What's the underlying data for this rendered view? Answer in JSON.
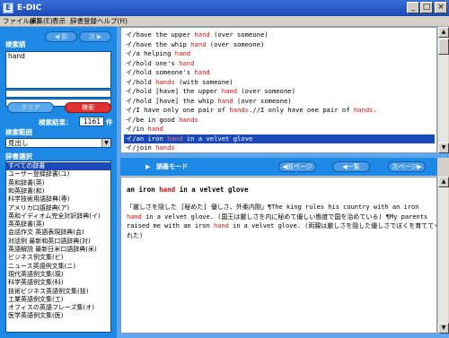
{
  "window": {
    "title": "E-DIC",
    "minimize": "_",
    "maximize": "□",
    "close": "×"
  },
  "menu": [
    "ファイル(F)",
    "編集(E)",
    "表示",
    "辞書登録",
    "ヘルプ(H)"
  ],
  "left": {
    "search_label": "検索語",
    "nav_back": "前",
    "nav_forward": "次",
    "search_value": "hand",
    "clear_button": "クリア",
    "search_button": "検索",
    "results_count_label": "検索結果：",
    "results_count": "1161",
    "results_unit": "件",
    "search_range_label": "検索範囲",
    "search_range_value": "見出し",
    "dict_select_label": "辞書選択",
    "dictionaries": [
      "すべての辞書",
      "ユーザー登録辞書(ユ)",
      "英和辞書(英)",
      "和英辞書(和)",
      "科学技術用語辞典(専)",
      "アメリカ口語辞典(ア)",
      "英和イディオム完全対訳辞典(イ)",
      "英英辞書(英)",
      "会話作文 英語表現辞典(会)",
      "対話例 最新和英口語辞典(対)",
      "英語解説 最新日米口語辞典(米)",
      "ビジネス例文集(ビ)",
      "ニュース英語例文集(ニ)",
      "現代英語例文集(現)",
      "科学英語例文集(科)",
      "技術ビジネス英語例文集(技)",
      "工業英語例文集(工)",
      "オフィスの英語フレーズ集(オ)",
      "医学英語例文集(医)"
    ],
    "selected_dictionary_index": 0
  },
  "results": {
    "items": [
      {
        "prefix": "イ/",
        "parts": [
          "have the upper ",
          "hand",
          " (over someone)"
        ]
      },
      {
        "prefix": "イ/",
        "parts": [
          "have the whip ",
          "hand",
          " (over someone)"
        ]
      },
      {
        "prefix": "イ/",
        "parts": [
          "a helping ",
          "hand",
          ""
        ]
      },
      {
        "prefix": "イ/",
        "parts": [
          "hold one's ",
          "hand",
          ""
        ]
      },
      {
        "prefix": "イ/",
        "parts": [
          "hold someone's ",
          "hand",
          ""
        ]
      },
      {
        "prefix": "イ/",
        "parts": [
          "hold ",
          "hands",
          " (with someone)"
        ]
      },
      {
        "prefix": "イ/",
        "parts": [
          "hold [have] the upper ",
          "hand",
          " (over someone)"
        ]
      },
      {
        "prefix": "イ/",
        "parts": [
          "hold [have] the whip ",
          "hand",
          " (over someone)"
        ]
      },
      {
        "prefix": "イ/",
        "parts": [
          "I have only one pair of ",
          "hands",
          ".//I only have one pair of ",
          "hands",
          "."
        ]
      },
      {
        "prefix": "イ/",
        "parts": [
          "be in good ",
          "hands",
          ""
        ]
      },
      {
        "prefix": "イ/",
        "parts": [
          "in ",
          "hand",
          ""
        ]
      },
      {
        "prefix": "イ/",
        "parts": [
          "an iron ",
          "hand",
          " in a velvet glove"
        ]
      },
      {
        "prefix": "イ/",
        "parts": [
          "join ",
          "hands",
          ""
        ]
      }
    ],
    "selected_index": 11
  },
  "toolbar": {
    "mode_label": "語義モード",
    "prev_page": "前ページ",
    "list": "一覧",
    "next_page": "次ページ"
  },
  "detail": {
    "headword_parts": [
      "an iron ",
      "hand",
      " in a velvet glove"
    ],
    "body_lines": [
      [
        "「厳しさを隠した [秘めた] 優しさ、外柔内剛」¶The king rules his country with an iron"
      ],
      [
        "",
        "hand",
        " in a velvet glove. (国王は厳しさを内に秘めて優しい態度で国を治めている) ¶My parents"
      ],
      [
        "raised me with an iron ",
        "hand",
        " in a velvet glove. (両親は厳しさを隠した優しさでぼくを育ててくれ"
      ],
      [
        "れた)"
      ]
    ]
  }
}
